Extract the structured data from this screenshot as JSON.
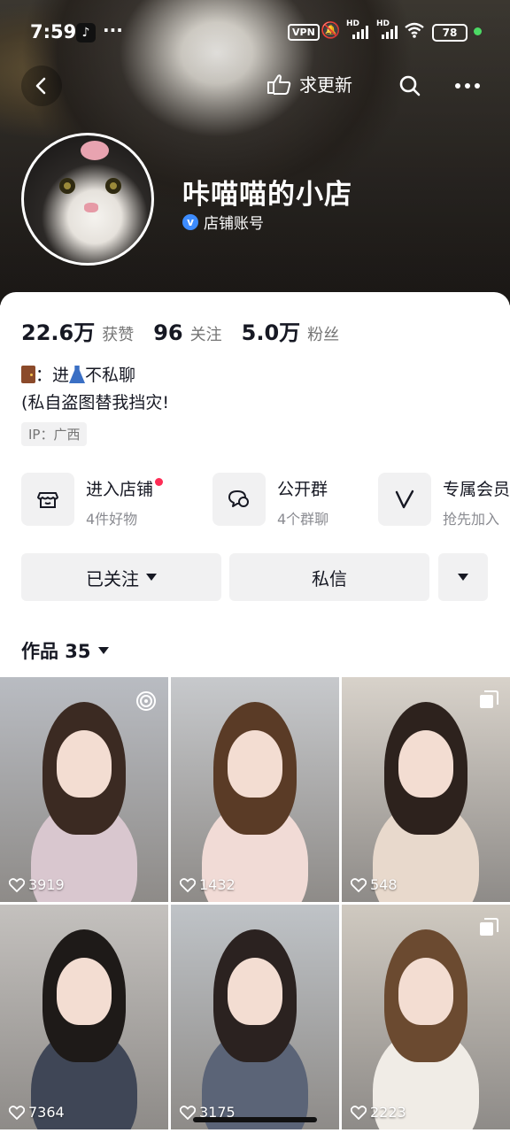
{
  "status_bar": {
    "time": "7:59",
    "app_glyph": "♪",
    "dots": "···",
    "vpn": "VPN",
    "hd1": "HD",
    "hd2": "HD",
    "battery": "78"
  },
  "header": {
    "back_icon": "back-arrow-icon",
    "update_label": "求更新",
    "search_icon": "search-icon",
    "more_icon": "more-icon"
  },
  "profile": {
    "name": "咔喵喵的小店",
    "account_type": "店铺账号",
    "verified_mark": "v"
  },
  "stats": [
    {
      "value": "22.6万",
      "label": "获赞"
    },
    {
      "value": "96",
      "label": "关注"
    },
    {
      "value": "5.0万",
      "label": "粉丝"
    }
  ],
  "bio": {
    "line1_sep": "：进",
    "line1_rest": "不私聊",
    "line2": "(私自盗图替我挡灾!",
    "ip": "IP：广西"
  },
  "features": [
    {
      "title": "进入店铺",
      "sub": "4件好物",
      "icon": "shop-icon"
    },
    {
      "title": "公开群",
      "sub": "4个群聊",
      "icon": "group-chat-icon"
    },
    {
      "title": "专属会员",
      "sub": "抢先加入",
      "icon": "vip-icon"
    }
  ],
  "actions": {
    "follow": "已关注",
    "message": "私信"
  },
  "works": {
    "label": "作品 35"
  },
  "videos": [
    {
      "likes": "3919",
      "bg": "#b9bcc2",
      "hair": "#3b2a22",
      "shirt": "#d9c7cf"
    },
    {
      "likes": "1432",
      "bg": "#c7c9cc",
      "hair": "#5a3b26",
      "shirt": "#f1dbd6"
    },
    {
      "likes": "548",
      "bg": "#d8d2ca",
      "hair": "#2d221d",
      "shirt": "#e8d9cc"
    },
    {
      "likes": "7364",
      "bg": "#c4c1be",
      "hair": "#1e1a18",
      "shirt": "#3f4656"
    },
    {
      "likes": "3175",
      "bg": "#bfc3c7",
      "hair": "#2b2220",
      "shirt": "#5b6477"
    },
    {
      "likes": "2223",
      "bg": "#cfc9c0",
      "hair": "#6b4a30",
      "shirt": "#f0ece6"
    }
  ]
}
